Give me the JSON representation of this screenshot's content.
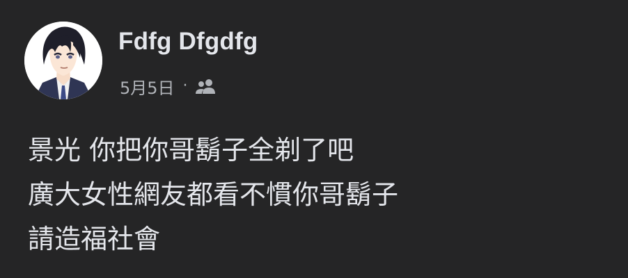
{
  "post": {
    "author_name": "Fdfg Dfgdfg",
    "date": "5月5日",
    "separator": "·",
    "audience_icon": "friends-icon",
    "avatar_icon": "profile-avatar",
    "lines": [
      "景光 你把你哥鬍子全剃了吧",
      "廣大女性網友都看不慣你哥鬍子",
      "請造福社會"
    ]
  },
  "colors": {
    "background": "#252526",
    "primary_text": "#e4e6eb",
    "secondary_text": "#b0b3b8"
  }
}
